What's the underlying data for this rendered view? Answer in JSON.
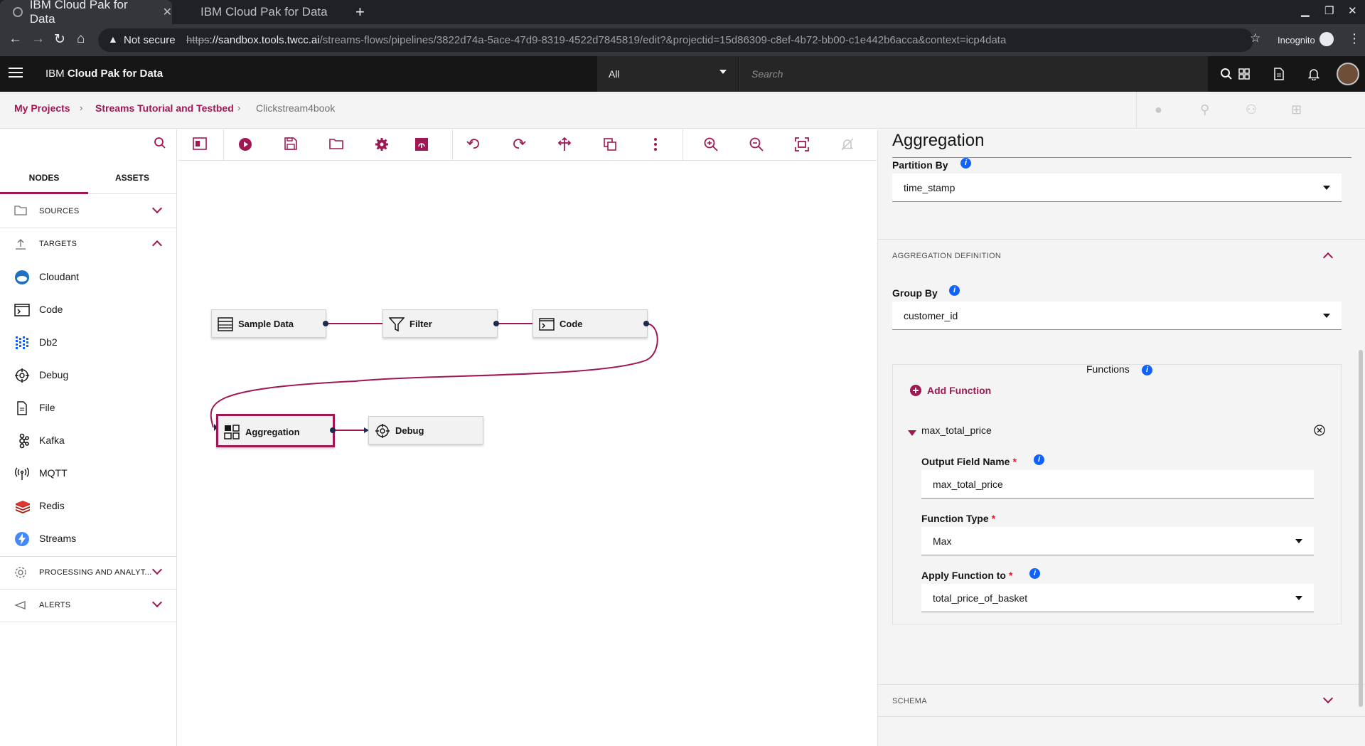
{
  "browser": {
    "tabs": [
      {
        "title": "IBM Cloud Pak for Data",
        "active": true
      },
      {
        "title": "IBM Cloud Pak for Data",
        "active": false
      }
    ],
    "not_secure": "Not secure",
    "url_scheme": "https",
    "url_host": "://sandbox.tools.twcc.ai",
    "url_path": "/streams-flows/pipelines/3822d74a-5ace-47d9-8319-4522d7845819/edit?&projectid=15d86309-c8ef-4b72-bb00-c1e442b6acca&context=icp4data",
    "incognito": "Incognito"
  },
  "header": {
    "brand_prefix": "IBM ",
    "brand_name": "Cloud Pak for Data",
    "scope": "All",
    "search_placeholder": "Search"
  },
  "breadcrumb": {
    "items": [
      "My Projects",
      "Streams Tutorial and Testbed"
    ],
    "current": "Clickstream4book"
  },
  "palette": {
    "tabs": [
      "NODES",
      "ASSETS"
    ],
    "categories": {
      "sources": "SOURCES",
      "targets": "TARGETS",
      "processing": "PROCESSING AND ANALYT...",
      "alerts": "ALERTS"
    },
    "targets": [
      "Cloudant",
      "Code",
      "Db2",
      "Debug",
      "File",
      "Kafka",
      "MQTT",
      "Redis",
      "Streams"
    ]
  },
  "canvas": {
    "nodes": {
      "sample_data": "Sample Data",
      "filter": "Filter",
      "code": "Code",
      "aggregation": "Aggregation",
      "debug": "Debug"
    }
  },
  "properties": {
    "title": "Aggregation",
    "partition_by_label": "Partition By",
    "partition_by_value": "time_stamp",
    "aggregation_definition": "AGGREGATION DEFINITION",
    "group_by_label": "Group By",
    "group_by_value": "customer_id",
    "functions_label": "Functions",
    "add_function": "Add Function",
    "function": {
      "name": "max_total_price",
      "output_field_label": "Output Field Name",
      "output_field_value": "max_total_price",
      "function_type_label": "Function Type",
      "function_type_value": "Max",
      "apply_to_label": "Apply Function to",
      "apply_to_value": "total_price_of_basket"
    },
    "schema": "SCHEMA"
  },
  "colors": {
    "accent": "#9f1853",
    "header_bg": "#161616",
    "info_blue": "#0f62fe",
    "port": "#1d2b4f"
  },
  "icons": {
    "toolbar": [
      "palette-toggle-icon",
      "run-icon",
      "save-icon",
      "open-icon",
      "settings-icon",
      "export-icon",
      "undo-icon",
      "redo-icon",
      "arrange-icon",
      "duplicate-icon",
      "more-icon",
      "zoom-in-icon",
      "zoom-out-icon",
      "fit-icon",
      "notifications-off-icon"
    ]
  }
}
